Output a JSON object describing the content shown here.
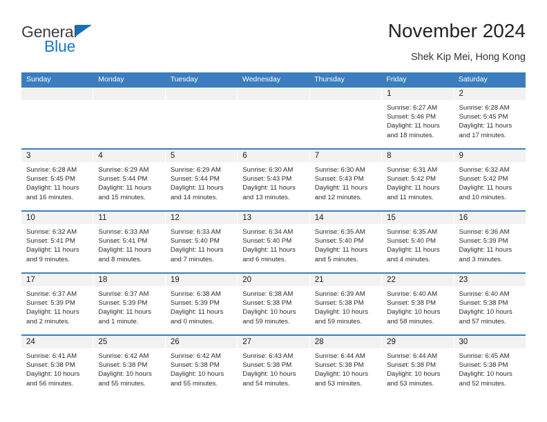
{
  "brand": {
    "name_part1": "General",
    "name_part2": "Blue",
    "accent_color": "#1879c4",
    "triangle_color": "#1a6eb5"
  },
  "header": {
    "title": "November 2024",
    "subtitle": "Shek Kip Mei, Hong Kong"
  },
  "calendar": {
    "header_bg": "#3b7dbf",
    "day_band_bg": "#f2f2f2",
    "weekdays": [
      "Sunday",
      "Monday",
      "Tuesday",
      "Wednesday",
      "Thursday",
      "Friday",
      "Saturday"
    ],
    "weeks": [
      [
        {
          "day": "",
          "lines": []
        },
        {
          "day": "",
          "lines": []
        },
        {
          "day": "",
          "lines": []
        },
        {
          "day": "",
          "lines": []
        },
        {
          "day": "",
          "lines": []
        },
        {
          "day": "1",
          "lines": [
            "Sunrise: 6:27 AM",
            "Sunset: 5:46 PM",
            "Daylight: 11 hours",
            "and 18 minutes."
          ]
        },
        {
          "day": "2",
          "lines": [
            "Sunrise: 6:28 AM",
            "Sunset: 5:45 PM",
            "Daylight: 11 hours",
            "and 17 minutes."
          ]
        }
      ],
      [
        {
          "day": "3",
          "lines": [
            "Sunrise: 6:28 AM",
            "Sunset: 5:45 PM",
            "Daylight: 11 hours",
            "and 16 minutes."
          ]
        },
        {
          "day": "4",
          "lines": [
            "Sunrise: 6:29 AM",
            "Sunset: 5:44 PM",
            "Daylight: 11 hours",
            "and 15 minutes."
          ]
        },
        {
          "day": "5",
          "lines": [
            "Sunrise: 6:29 AM",
            "Sunset: 5:44 PM",
            "Daylight: 11 hours",
            "and 14 minutes."
          ]
        },
        {
          "day": "6",
          "lines": [
            "Sunrise: 6:30 AM",
            "Sunset: 5:43 PM",
            "Daylight: 11 hours",
            "and 13 minutes."
          ]
        },
        {
          "day": "7",
          "lines": [
            "Sunrise: 6:30 AM",
            "Sunset: 5:43 PM",
            "Daylight: 11 hours",
            "and 12 minutes."
          ]
        },
        {
          "day": "8",
          "lines": [
            "Sunrise: 6:31 AM",
            "Sunset: 5:42 PM",
            "Daylight: 11 hours",
            "and 11 minutes."
          ]
        },
        {
          "day": "9",
          "lines": [
            "Sunrise: 6:32 AM",
            "Sunset: 5:42 PM",
            "Daylight: 11 hours",
            "and 10 minutes."
          ]
        }
      ],
      [
        {
          "day": "10",
          "lines": [
            "Sunrise: 6:32 AM",
            "Sunset: 5:41 PM",
            "Daylight: 11 hours",
            "and 9 minutes."
          ]
        },
        {
          "day": "11",
          "lines": [
            "Sunrise: 6:33 AM",
            "Sunset: 5:41 PM",
            "Daylight: 11 hours",
            "and 8 minutes."
          ]
        },
        {
          "day": "12",
          "lines": [
            "Sunrise: 6:33 AM",
            "Sunset: 5:40 PM",
            "Daylight: 11 hours",
            "and 7 minutes."
          ]
        },
        {
          "day": "13",
          "lines": [
            "Sunrise: 6:34 AM",
            "Sunset: 5:40 PM",
            "Daylight: 11 hours",
            "and 6 minutes."
          ]
        },
        {
          "day": "14",
          "lines": [
            "Sunrise: 6:35 AM",
            "Sunset: 5:40 PM",
            "Daylight: 11 hours",
            "and 5 minutes."
          ]
        },
        {
          "day": "15",
          "lines": [
            "Sunrise: 6:35 AM",
            "Sunset: 5:40 PM",
            "Daylight: 11 hours",
            "and 4 minutes."
          ]
        },
        {
          "day": "16",
          "lines": [
            "Sunrise: 6:36 AM",
            "Sunset: 5:39 PM",
            "Daylight: 11 hours",
            "and 3 minutes."
          ]
        }
      ],
      [
        {
          "day": "17",
          "lines": [
            "Sunrise: 6:37 AM",
            "Sunset: 5:39 PM",
            "Daylight: 11 hours",
            "and 2 minutes."
          ]
        },
        {
          "day": "18",
          "lines": [
            "Sunrise: 6:37 AM",
            "Sunset: 5:39 PM",
            "Daylight: 11 hours",
            "and 1 minute."
          ]
        },
        {
          "day": "19",
          "lines": [
            "Sunrise: 6:38 AM",
            "Sunset: 5:39 PM",
            "Daylight: 11 hours",
            "and 0 minutes."
          ]
        },
        {
          "day": "20",
          "lines": [
            "Sunrise: 6:38 AM",
            "Sunset: 5:38 PM",
            "Daylight: 10 hours",
            "and 59 minutes."
          ]
        },
        {
          "day": "21",
          "lines": [
            "Sunrise: 6:39 AM",
            "Sunset: 5:38 PM",
            "Daylight: 10 hours",
            "and 59 minutes."
          ]
        },
        {
          "day": "22",
          "lines": [
            "Sunrise: 6:40 AM",
            "Sunset: 5:38 PM",
            "Daylight: 10 hours",
            "and 58 minutes."
          ]
        },
        {
          "day": "23",
          "lines": [
            "Sunrise: 6:40 AM",
            "Sunset: 5:38 PM",
            "Daylight: 10 hours",
            "and 57 minutes."
          ]
        }
      ],
      [
        {
          "day": "24",
          "lines": [
            "Sunrise: 6:41 AM",
            "Sunset: 5:38 PM",
            "Daylight: 10 hours",
            "and 56 minutes."
          ]
        },
        {
          "day": "25",
          "lines": [
            "Sunrise: 6:42 AM",
            "Sunset: 5:38 PM",
            "Daylight: 10 hours",
            "and 55 minutes."
          ]
        },
        {
          "day": "26",
          "lines": [
            "Sunrise: 6:42 AM",
            "Sunset: 5:38 PM",
            "Daylight: 10 hours",
            "and 55 minutes."
          ]
        },
        {
          "day": "27",
          "lines": [
            "Sunrise: 6:43 AM",
            "Sunset: 5:38 PM",
            "Daylight: 10 hours",
            "and 54 minutes."
          ]
        },
        {
          "day": "28",
          "lines": [
            "Sunrise: 6:44 AM",
            "Sunset: 5:38 PM",
            "Daylight: 10 hours",
            "and 53 minutes."
          ]
        },
        {
          "day": "29",
          "lines": [
            "Sunrise: 6:44 AM",
            "Sunset: 5:38 PM",
            "Daylight: 10 hours",
            "and 53 minutes."
          ]
        },
        {
          "day": "30",
          "lines": [
            "Sunrise: 6:45 AM",
            "Sunset: 5:38 PM",
            "Daylight: 10 hours",
            "and 52 minutes."
          ]
        }
      ]
    ]
  }
}
